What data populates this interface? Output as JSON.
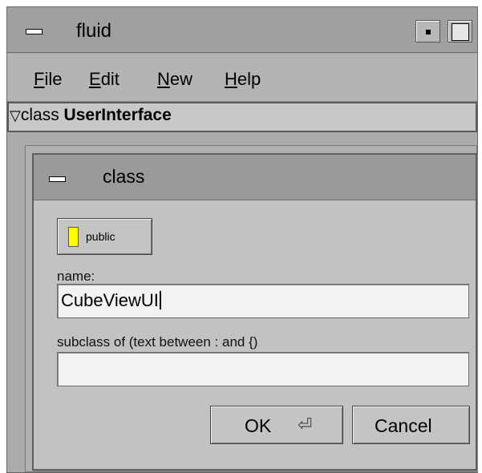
{
  "window": {
    "title": "fluid"
  },
  "menu": {
    "items": [
      {
        "mnemonic": "F",
        "rest": "ile"
      },
      {
        "mnemonic": "E",
        "rest": "dit"
      },
      {
        "mnemonic": "N",
        "rest": "ew"
      },
      {
        "mnemonic": "H",
        "rest": "elp"
      }
    ]
  },
  "browser": {
    "arrow": "▽",
    "kind": "class",
    "name": "UserInterface"
  },
  "dialog": {
    "title": "class",
    "public_label": "public",
    "name_label": "name:",
    "name_value": "CubeViewUI",
    "subclass_label": "subclass of (text between : and {)",
    "subclass_value": "",
    "ok_label": "OK",
    "ok_icon": "⏎",
    "cancel_label": "Cancel"
  },
  "colors": {
    "indicator": "#ffff00",
    "title_bg": "#9a9a9a",
    "dialog_bg": "#c2c2c2"
  },
  "icons": [
    "window-menu-icon",
    "iconify-icon",
    "maximize-icon",
    "return-key-icon"
  ]
}
